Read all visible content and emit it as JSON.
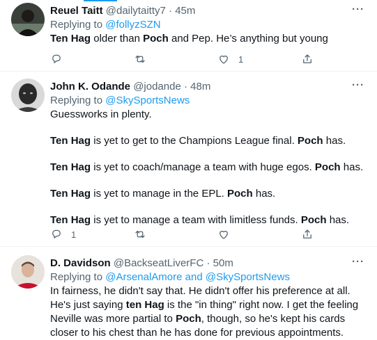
{
  "tweets": [
    {
      "name": "Reuel Taitt",
      "handle": "@dailytaitty7",
      "sep": "·",
      "time": "45m",
      "replying_prefix": "Replying to ",
      "replying_to": "@follyzSZN",
      "body_parts": [
        {
          "b": "Ten Hag"
        },
        {
          "t": " older than "
        },
        {
          "b": "Poch"
        },
        {
          "t": " and Pep. He’s anything but young"
        }
      ],
      "counts": {
        "reply": "",
        "retweet": "",
        "like": "1",
        "share": ""
      }
    },
    {
      "name": "John K. Odande",
      "handle": "@jodande",
      "sep": "·",
      "time": "48m",
      "replying_prefix": "Replying to ",
      "replying_to": "@SkySportsNews",
      "paragraphs": [
        [
          {
            "t": "Guessworks in plenty."
          }
        ],
        [
          {
            "b": "Ten Hag"
          },
          {
            "t": " is yet to get to the Champions League final. "
          },
          {
            "b": "Poch"
          },
          {
            "t": " has."
          }
        ],
        [
          {
            "b": "Ten Hag"
          },
          {
            "t": " is yet to coach/manage a team with huge egos. "
          },
          {
            "b": "Poch"
          },
          {
            "t": " has."
          }
        ],
        [
          {
            "b": "Ten Hag"
          },
          {
            "t": " is yet to manage in the EPL. "
          },
          {
            "b": "Poch"
          },
          {
            "t": " has."
          }
        ],
        [
          {
            "b": "Ten Hag"
          },
          {
            "t": " is yet to manage a team with limitless funds. "
          },
          {
            "b": "Poch"
          },
          {
            "t": " has."
          }
        ]
      ],
      "counts": {
        "reply": "1",
        "retweet": "",
        "like": "",
        "share": ""
      }
    },
    {
      "name": "D. Davidson",
      "handle": "@BackseatLiverFC",
      "sep": "·",
      "time": "50m",
      "replying_prefix": "Replying to ",
      "replying_to": "@ArsenalAmore and @SkySportsNews",
      "body_parts": [
        {
          "t": "In fairness, he didn't say that. He didn't offer his preference at all. He's just saying "
        },
        {
          "b": "ten Hag"
        },
        {
          "t": " is the \"in thing\" right now. I get the feeling Neville was more partial to "
        },
        {
          "b": "Poch"
        },
        {
          "t": ", though, so he's kept his cards closer to his chest than he has done for previous appointments."
        }
      ]
    }
  ],
  "colors": {
    "accent": "#1d9bf0",
    "muted": "#536471",
    "text": "#0f1419",
    "divider": "#eff3f4"
  },
  "icons": {
    "reply": "reply-icon",
    "retweet": "retweet-icon",
    "like": "heart-icon",
    "share": "share-icon",
    "more": "more-icon"
  }
}
